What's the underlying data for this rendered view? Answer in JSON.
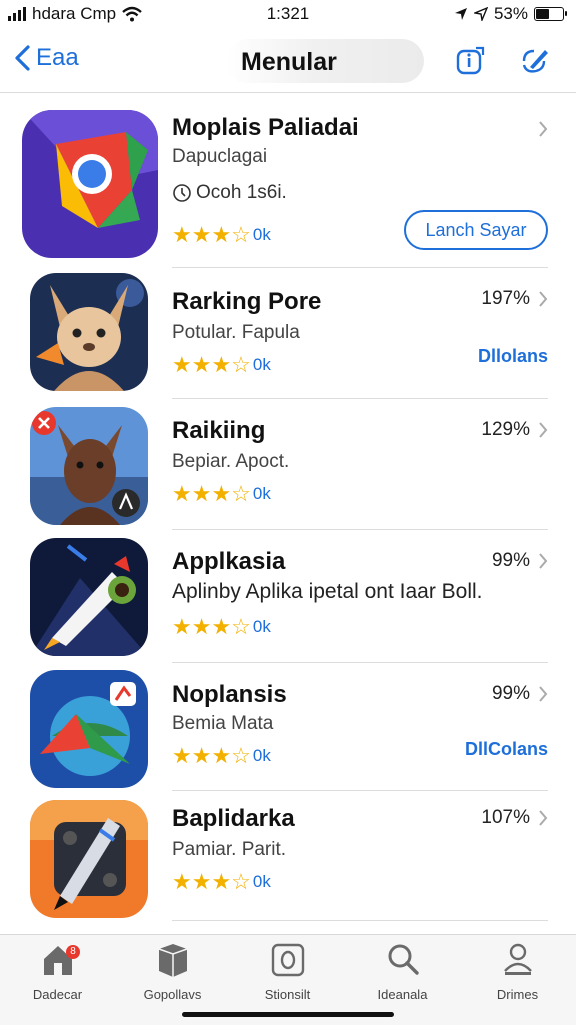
{
  "status_bar": {
    "carrier": "hdara Cmp",
    "time": "1:321",
    "battery": "53%",
    "battery_level": 0.53
  },
  "nav": {
    "back_label": "Eaa",
    "title": "Menular",
    "icons": [
      "info-icon",
      "compose-icon"
    ]
  },
  "apps": [
    {
      "name": "Moplais Paliadai",
      "subtitle": "Dapuclagai",
      "meta": "Ocoh 1s6i.",
      "stars": "★★★☆",
      "rating_count": "0k",
      "button_label": "Lanch Sayar",
      "icon": "chrome-like-icon"
    },
    {
      "name": "Rarking Pore",
      "subtitle": "Potular. Fapula",
      "stars": "★★★☆",
      "rating_count": "0k",
      "percent": "197%",
      "link": "Dllolans",
      "icon": "kangaroo-icon"
    },
    {
      "name": "Raikiing",
      "subtitle": "Bepiar. Apoct.",
      "stars": "★★★☆",
      "rating_count": "0k",
      "percent": "129%",
      "icon": "horse-icon"
    },
    {
      "name": "Applkasia",
      "subtitle": "Aplinby Aplika ipetal ont Iaar Boll.",
      "stars": "★★★☆",
      "rating_count": "0k",
      "percent": "99%",
      "icon": "rocket-icon"
    },
    {
      "name": "Noplansis",
      "subtitle": "Bemia Mata",
      "stars": "★★★☆",
      "rating_count": "0k",
      "percent": "99%",
      "link": "DllColans",
      "icon": "globe-arrow-icon"
    },
    {
      "name": "Baplidarka",
      "subtitle": "Pamiar. Parit.",
      "stars": "★★★☆",
      "rating_count": "0k",
      "percent": "107%",
      "icon": "pen-tool-icon"
    }
  ],
  "tab_bar": {
    "badge": "8",
    "tabs": [
      {
        "label": "Dadecar",
        "icon": "home-icon"
      },
      {
        "label": "Gopollavs",
        "icon": "box-icon"
      },
      {
        "label": "Stionsilt",
        "icon": "square-circle-icon"
      },
      {
        "label": "Ideanala",
        "icon": "search-icon"
      },
      {
        "label": "Drimes",
        "icon": "person-icon"
      }
    ]
  },
  "colors": {
    "accent": "#1e6fd9",
    "star": "#f2b100",
    "badge": "#e8372c"
  }
}
